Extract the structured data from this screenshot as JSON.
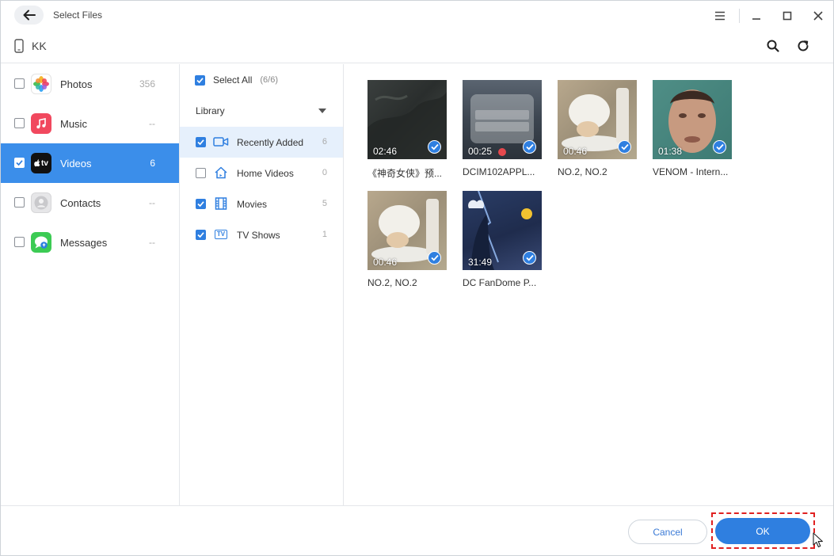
{
  "window": {
    "title": "Select Files"
  },
  "device": {
    "name": "KK"
  },
  "categories": [
    {
      "label": "Photos",
      "count": "356",
      "checked": false,
      "active": false,
      "icon": "photos-app-icon"
    },
    {
      "label": "Music",
      "count": "--",
      "checked": false,
      "active": false,
      "icon": "music-app-icon"
    },
    {
      "label": "Videos",
      "count": "6",
      "checked": true,
      "active": true,
      "icon": "apple-tv-app-icon",
      "icon_text": "tv"
    },
    {
      "label": "Contacts",
      "count": "--",
      "checked": false,
      "active": false,
      "icon": "contacts-app-icon"
    },
    {
      "label": "Messages",
      "count": "--",
      "checked": false,
      "active": false,
      "icon": "messages-app-icon"
    }
  ],
  "library": {
    "select_all_label": "Select All",
    "select_all_count": "(6/6)",
    "header": "Library",
    "items": [
      {
        "label": "Recently Added",
        "count": "6",
        "checked": true,
        "active": true,
        "icon": "recently-added-icon"
      },
      {
        "label": "Home Videos",
        "count": "0",
        "checked": false,
        "active": false,
        "icon": "home-icon"
      },
      {
        "label": "Movies",
        "count": "5",
        "checked": true,
        "active": false,
        "icon": "film-icon"
      },
      {
        "label": "TV Shows",
        "count": "1",
        "checked": true,
        "active": false,
        "icon": "tv-icon",
        "icon_text": "TV"
      }
    ]
  },
  "videos": [
    {
      "name": "《神奇女侠》预...",
      "duration": "02:46",
      "checked": true
    },
    {
      "name": "DCIM102APPL...",
      "duration": "00:25",
      "checked": true
    },
    {
      "name": "NO.2, NO.2",
      "duration": "00:46",
      "checked": true
    },
    {
      "name": "VENOM - Intern...",
      "duration": "01:38",
      "checked": true
    },
    {
      "name": "NO.2, NO.2",
      "duration": "00:46",
      "checked": true
    },
    {
      "name": "DC FanDome P...",
      "duration": "31:49",
      "checked": true
    }
  ],
  "footer": {
    "cancel_label": "Cancel",
    "ok_label": "OK"
  },
  "colors": {
    "accent": "#2f7fe0",
    "active_row": "#3b8eea",
    "highlight_frame": "#e02020"
  }
}
